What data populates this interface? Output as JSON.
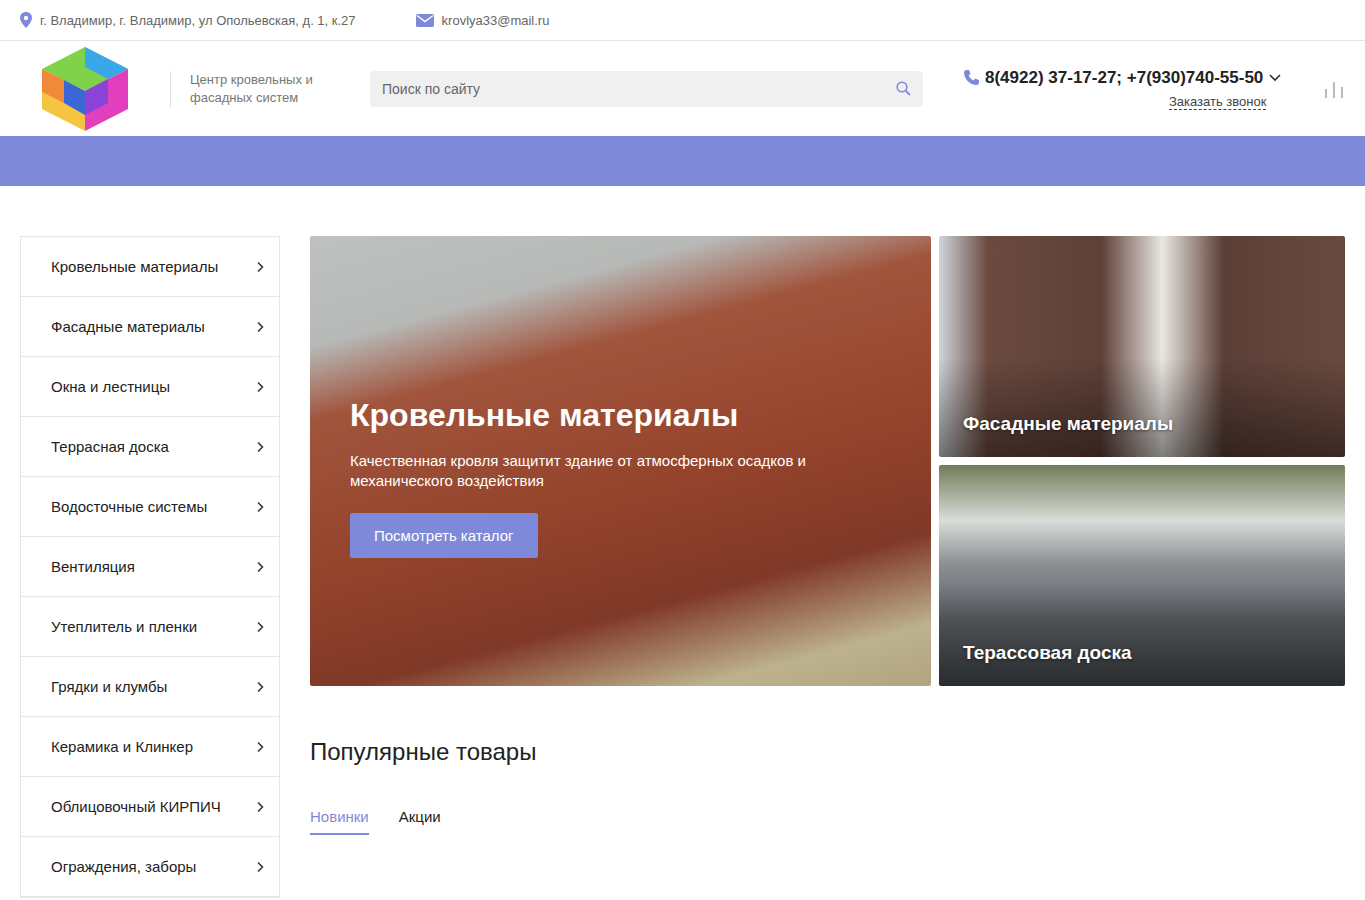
{
  "topbar": {
    "address": "г. Владимир, г. Владимир, ул Опольевская, д. 1, к.27",
    "email": "krovlya33@mail.ru"
  },
  "header": {
    "tagline": "Центр кровельных и фасадных систем",
    "search": {
      "placeholder": "Поиск по сайту"
    },
    "phone": "8(4922) 37-17-27; +7(930)740-55-50",
    "callback": "Заказать звонок"
  },
  "sidebar": {
    "items": [
      "Кровельные материалы",
      "Фасадные материалы",
      "Окна и лестницы",
      "Террасная доска",
      "Водосточные системы",
      "Вентиляция",
      "Утеплитель и пленки",
      "Грядки и клумбы",
      "Керамика и Клинкер",
      "Облицовочный КИРПИЧ",
      "Ограждения, заборы"
    ]
  },
  "banner": {
    "title": "Кровельные материалы",
    "text": "Качественная кровля защитит здание от атмосферных осадков и механического воздействия",
    "button": "Посмотреть каталог"
  },
  "cards": [
    {
      "title": "Фасадные материалы"
    },
    {
      "title": "Терассовая доска"
    }
  ],
  "popular": {
    "title": "Популярные товары",
    "tabs": [
      {
        "label": "Новинки",
        "selected": true
      },
      {
        "label": "Акции",
        "selected": false
      }
    ]
  }
}
